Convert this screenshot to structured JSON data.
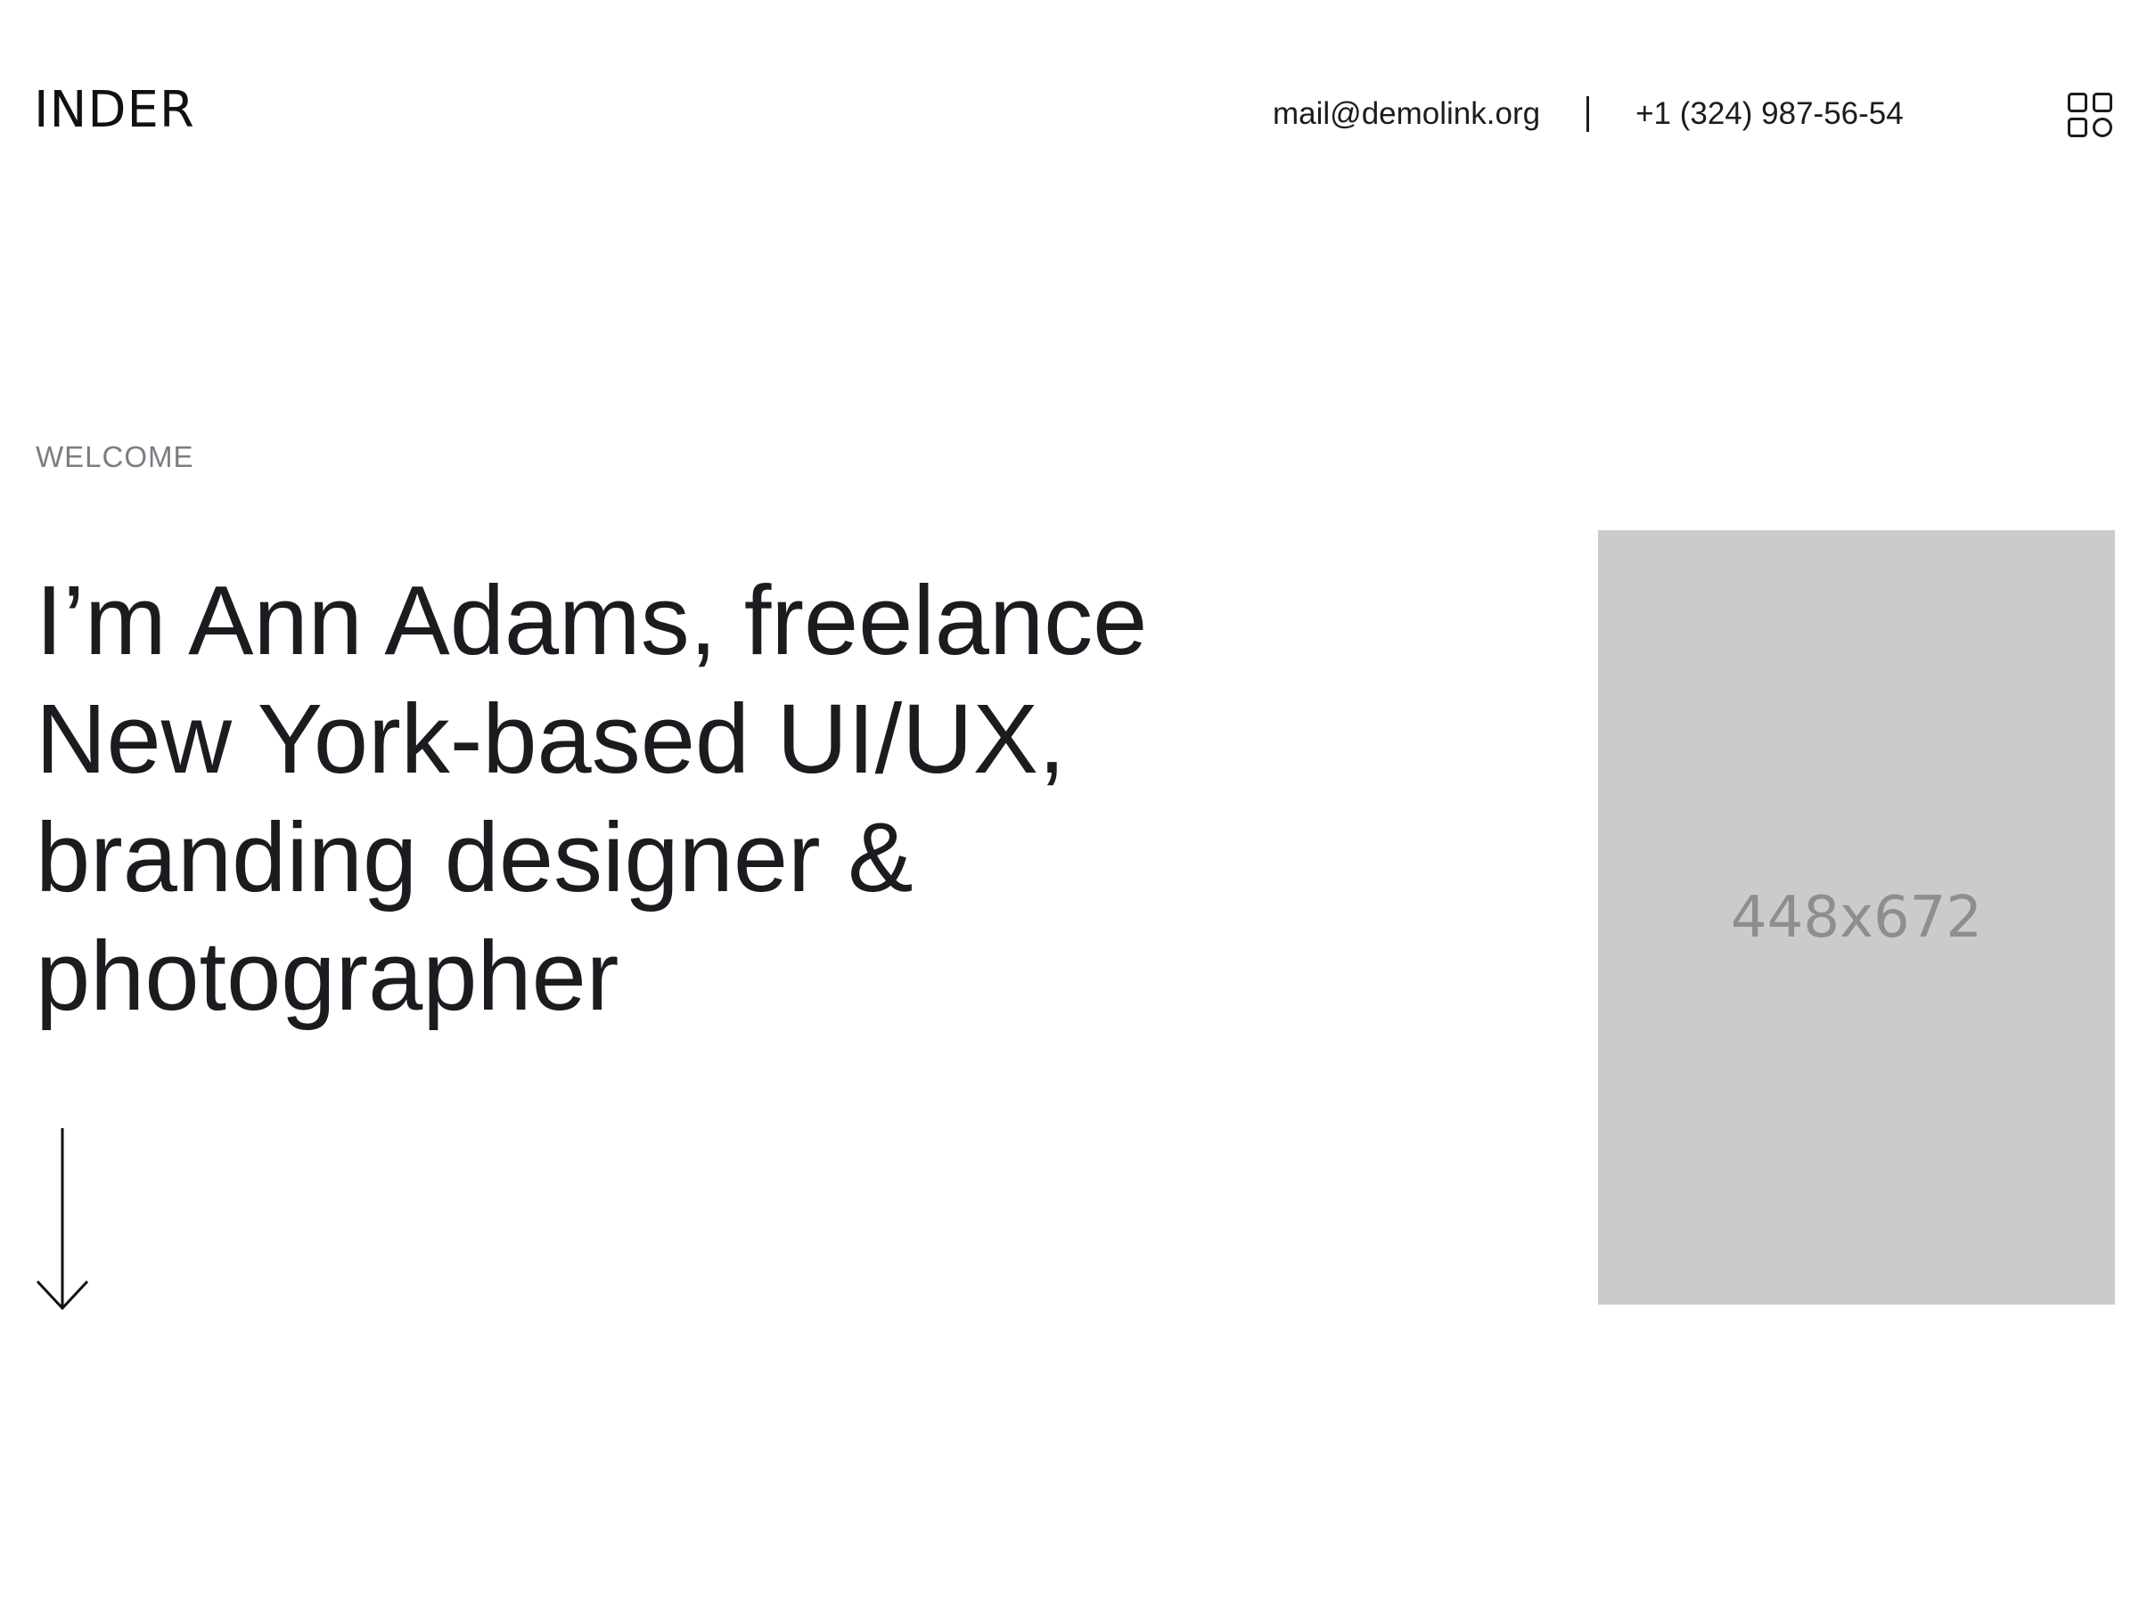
{
  "header": {
    "logo": "INDER",
    "email": "mail@demolink.org",
    "phone": "+1 (324) 987-56-54",
    "menu_icon": "grid-icon"
  },
  "hero": {
    "eyebrow": "WELCOME",
    "title": "I’m Ann Adams, freelance New York-based UI/UX, branding designer & photographer",
    "scroll_icon": "arrow-down-icon",
    "image_placeholder": "448x672"
  },
  "colors": {
    "text": "#1a1c20",
    "muted": "#7a7d82",
    "placeholder_bg": "#cbcbcb",
    "placeholder_text": "#8e8e8e"
  }
}
